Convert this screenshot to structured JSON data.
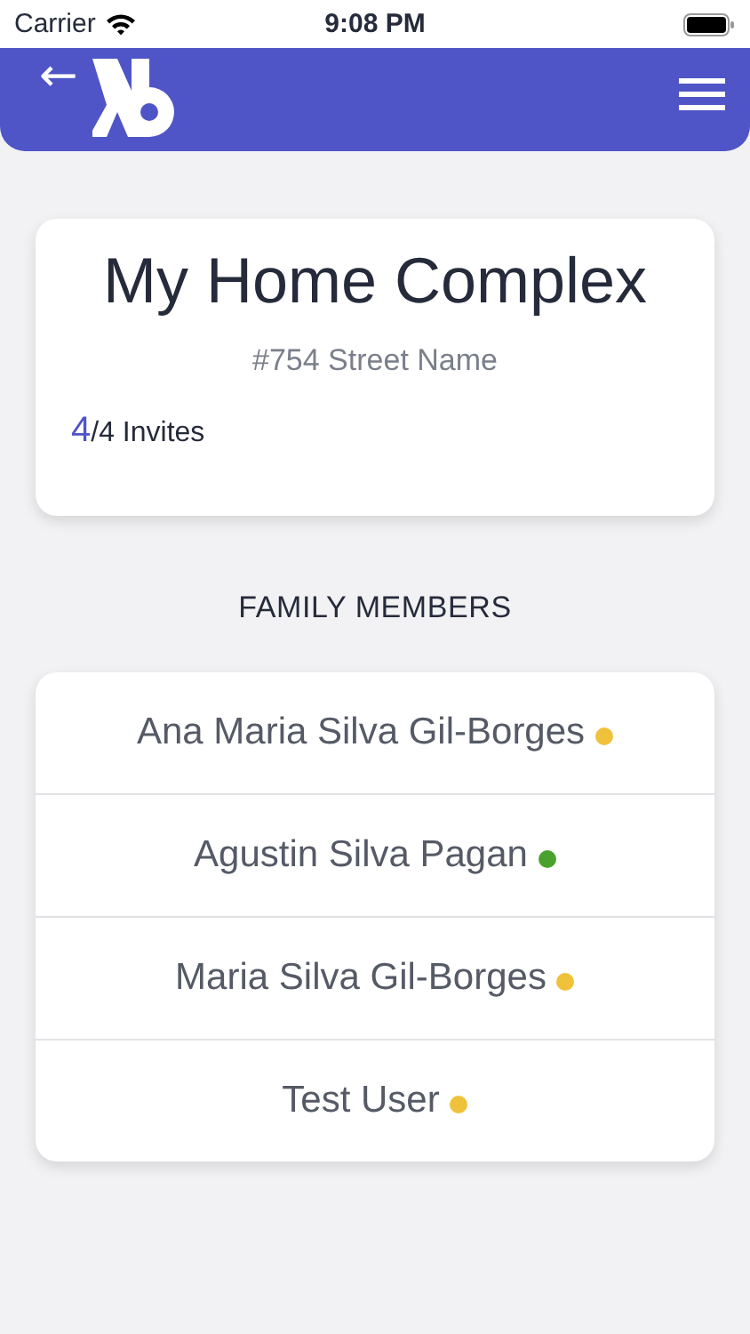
{
  "status_bar": {
    "carrier": "Carrier",
    "time": "9:08 PM"
  },
  "header": {
    "back": "←"
  },
  "complex": {
    "title": "My Home Complex",
    "address": "#754 Street Name",
    "invites_used": "4",
    "invites_total": "/4 Invites"
  },
  "section_title": "FAMILY MEMBERS",
  "members": [
    {
      "name": "Ana Maria Silva Gil-Borges",
      "color": "#f0c13a"
    },
    {
      "name": "Agustin Silva Pagan",
      "color": "#4aa22e"
    },
    {
      "name": "Maria Silva Gil-Borges",
      "color": "#f0c13a"
    },
    {
      "name": "Test User",
      "color": "#f0c13a"
    }
  ]
}
